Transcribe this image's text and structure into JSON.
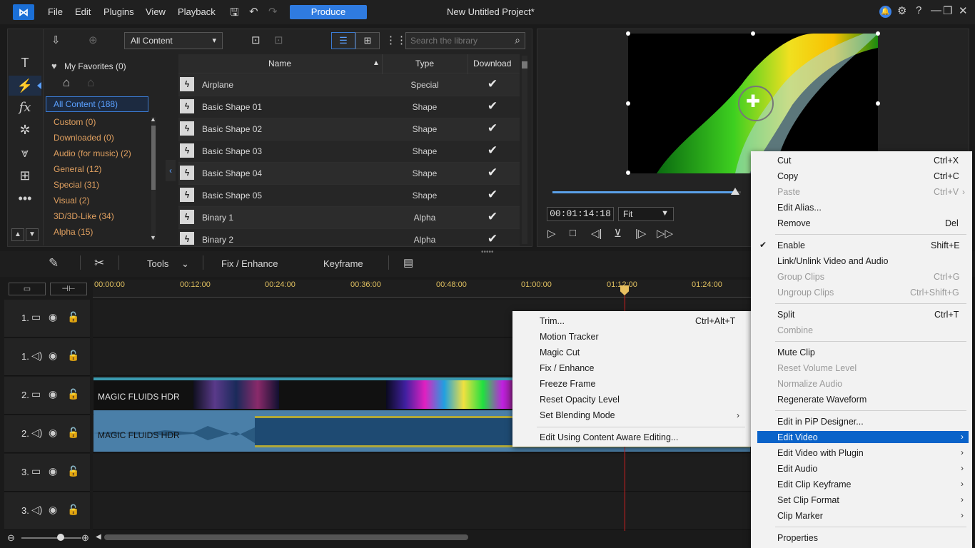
{
  "titlebar": {
    "menus": [
      "File",
      "Edit",
      "Plugins",
      "View",
      "Playback"
    ],
    "produce_label": "Produce",
    "project_title": "New Untitled Project*"
  },
  "library": {
    "content_filter": "All Content",
    "search_placeholder": "Search the library",
    "favorites_label": "My Favorites (0)",
    "categories_selected": "All Content (188)",
    "categories": [
      "Custom  (0)",
      "Downloaded  (0)",
      "Audio (for music)  (2)",
      "General  (12)",
      "Special  (31)",
      "Visual  (2)",
      "3D/3D-Like  (34)",
      "Alpha  (15)"
    ],
    "columns": {
      "name": "Name",
      "type": "Type",
      "download": "Download"
    },
    "rows": [
      {
        "name": "Airplane",
        "type": "Special",
        "download": "✔"
      },
      {
        "name": "Basic Shape 01",
        "type": "Shape",
        "download": "✔"
      },
      {
        "name": "Basic Shape 02",
        "type": "Shape",
        "download": "✔"
      },
      {
        "name": "Basic Shape 03",
        "type": "Shape",
        "download": "✔"
      },
      {
        "name": "Basic Shape 04",
        "type": "Shape",
        "download": "✔"
      },
      {
        "name": "Basic Shape 05",
        "type": "Shape",
        "download": "✔"
      },
      {
        "name": "Binary 1",
        "type": "Alpha",
        "download": "✔"
      },
      {
        "name": "Binary 2",
        "type": "Alpha",
        "download": "✔"
      }
    ]
  },
  "preview": {
    "timecode": "00:01:14:18",
    "fit_label": "Fit",
    "scrub_progress": 0.97
  },
  "edit_toolbar": {
    "tools_label": "Tools",
    "fix_enhance_label": "Fix / Enhance",
    "keyframe_label": "Keyframe"
  },
  "timeline": {
    "ticks": [
      "00:00:00",
      "00:12:00",
      "00:24:00",
      "00:36:00",
      "00:48:00",
      "01:00:00",
      "01:12:00",
      "01:24:00"
    ],
    "tracks": [
      {
        "num": "1.",
        "kind": "video"
      },
      {
        "num": "1.",
        "kind": "audio"
      },
      {
        "num": "2.",
        "kind": "video"
      },
      {
        "num": "2.",
        "kind": "audio"
      },
      {
        "num": "3.",
        "kind": "video"
      },
      {
        "num": "3.",
        "kind": "audio"
      }
    ],
    "clip_video_label": "MAGIC FLUIDS HDR",
    "clip_audio_label": "MAGIC FLUIDS HDR"
  },
  "submenu": {
    "items": [
      {
        "label": "Trim...",
        "shortcut": "Ctrl+Alt+T"
      },
      {
        "label": "Motion Tracker",
        "shortcut": ""
      },
      {
        "label": "Magic Cut",
        "shortcut": ""
      },
      {
        "label": "Fix / Enhance",
        "shortcut": ""
      },
      {
        "label": "Freeze Frame",
        "shortcut": ""
      },
      {
        "label": "Reset Opacity Level",
        "shortcut": ""
      },
      {
        "label": "Set Blending Mode",
        "shortcut": ""
      },
      {
        "label": "Edit Using Content Aware Editing...",
        "shortcut": ""
      }
    ]
  },
  "context_menu": {
    "items": [
      {
        "label": "Cut",
        "shortcut": "Ctrl+X"
      },
      {
        "label": "Copy",
        "shortcut": "Ctrl+C"
      },
      {
        "label": "Paste",
        "shortcut": "Ctrl+V"
      },
      {
        "label": "Edit Alias...",
        "shortcut": ""
      },
      {
        "label": "Remove",
        "shortcut": "Del"
      },
      {
        "label": "Enable",
        "shortcut": "Shift+E"
      },
      {
        "label": "Link/Unlink Video and Audio",
        "shortcut": ""
      },
      {
        "label": "Group Clips",
        "shortcut": "Ctrl+G"
      },
      {
        "label": "Ungroup Clips",
        "shortcut": "Ctrl+Shift+G"
      },
      {
        "label": "Split",
        "shortcut": "Ctrl+T"
      },
      {
        "label": "Combine",
        "shortcut": ""
      },
      {
        "label": "Mute Clip",
        "shortcut": ""
      },
      {
        "label": "Reset Volume Level",
        "shortcut": ""
      },
      {
        "label": "Normalize Audio",
        "shortcut": ""
      },
      {
        "label": "Regenerate Waveform",
        "shortcut": ""
      },
      {
        "label": "Edit in PiP Designer...",
        "shortcut": ""
      },
      {
        "label": "Edit Video",
        "shortcut": ""
      },
      {
        "label": "Edit Video with Plugin",
        "shortcut": ""
      },
      {
        "label": "Edit Audio",
        "shortcut": ""
      },
      {
        "label": "Edit Clip Keyframe",
        "shortcut": ""
      },
      {
        "label": "Set Clip Format",
        "shortcut": ""
      },
      {
        "label": "Clip Marker",
        "shortcut": ""
      },
      {
        "label": "Properties",
        "shortcut": ""
      }
    ],
    "checkmark": "✔"
  },
  "colors": {
    "accent": "#2f7be0",
    "menu_highlight": "#0a63c9",
    "playhead": "#d02020"
  }
}
